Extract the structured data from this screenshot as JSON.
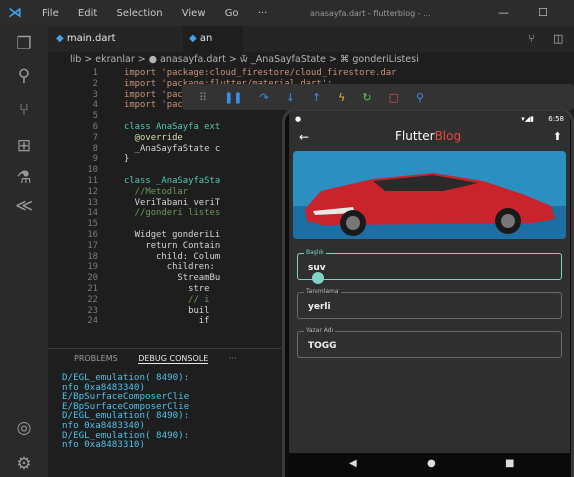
{
  "window": {
    "title": "anasayfa.dart - flutterblog - ..."
  },
  "menu": [
    "File",
    "Edit",
    "Selection",
    "View",
    "Go",
    "···"
  ],
  "tabs": [
    {
      "label": "main.dart"
    },
    {
      "label": "an"
    }
  ],
  "breadcrumb": "lib > ekranlar > ● anasayfa.dart > 🝃 _AnaSayfaState > ⌘ gonderiListesi",
  "code_lines": [
    {
      "num": "1",
      "text": "import 'package:cloud_firestore/cloud_firestore.dar"
    },
    {
      "num": "2",
      "text": "import 'package:flutter/material.dart';"
    },
    {
      "num": "3",
      "text": "import 'package:flutterblog/ekranlar/gonderiekle.da"
    },
    {
      "num": "4",
      "text": "import 'package:flut"
    },
    {
      "num": "5",
      "text": ""
    },
    {
      "num": "6",
      "text": "class AnaSayfa ext"
    },
    {
      "num": "7",
      "text": "  @override"
    },
    {
      "num": "8",
      "text": "  _AnaSayfaState c"
    },
    {
      "num": "9",
      "text": "}"
    },
    {
      "num": "10",
      "text": ""
    },
    {
      "num": "11",
      "text": "class _AnaSayfaSta"
    },
    {
      "num": "12",
      "text": "  //Metodlar"
    },
    {
      "num": "13",
      "text": "  VeriTabani veriT"
    },
    {
      "num": "14",
      "text": "  //gonderi listes"
    },
    {
      "num": "15",
      "text": ""
    },
    {
      "num": "16",
      "text": "  Widget gonderiLi"
    },
    {
      "num": "17",
      "text": "    return Contain"
    },
    {
      "num": "18",
      "text": "      child: Colum"
    },
    {
      "num": "19",
      "text": "        children:"
    },
    {
      "num": "20",
      "text": "          StreamBu"
    },
    {
      "num": "21",
      "text": "            stre"
    },
    {
      "num": "22",
      "text": "            // i"
    },
    {
      "num": "23",
      "text": "            buil"
    },
    {
      "num": "24",
      "text": "              if"
    }
  ],
  "panel": {
    "tabs": [
      "PROBLEMS",
      "DEBUG CONSOLE",
      "···"
    ],
    "lines": [
      "D/EGL_emulation( 8490):",
      "nfo 0xa8483340)",
      "E/BpSurfaceComposerClie",
      "E/BpSurfaceComposerClie",
      "D/EGL_emulation( 8490):",
      "nfo 0xa8483340)",
      "D/EGL_emulation( 8490):",
      "nfo 0xa8483310)"
    ]
  },
  "phone": {
    "status_time": "6:58",
    "app_title_part1": "Flutter",
    "app_title_part2": "Blog",
    "fields": [
      {
        "label": "Başlık",
        "value": "suv"
      },
      {
        "label": "Tanımlama",
        "value": "yerli"
      },
      {
        "label": "Yazar Adı",
        "value": "TOGG"
      }
    ]
  },
  "colors": {
    "accent": "#3ca4f0",
    "brand_red": "#e8463c",
    "field_focus": "#7ed3c4"
  }
}
